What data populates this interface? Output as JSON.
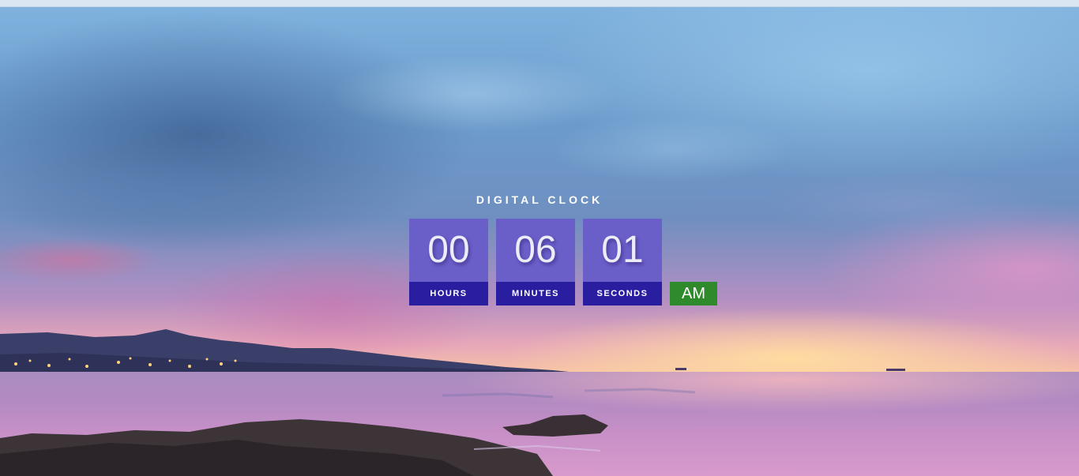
{
  "clock": {
    "title": "DIGITAL CLOCK",
    "hours": "00",
    "minutes": "06",
    "seconds": "01",
    "hours_label": "HOURS",
    "minutes_label": "MINUTES",
    "seconds_label": "SECONDS",
    "period": "AM"
  },
  "colors": {
    "value_box": "#6a5ec9",
    "label_box": "#2a1ea0",
    "period_badge": "#2f8a2c"
  }
}
